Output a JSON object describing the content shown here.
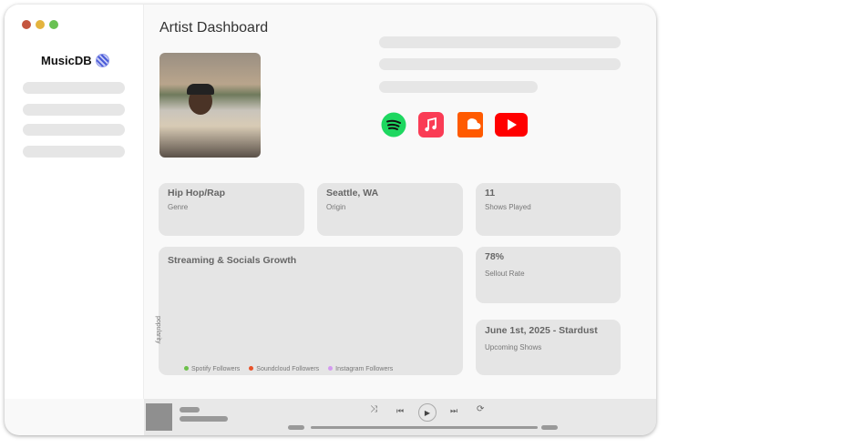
{
  "window": {
    "controls": {
      "close": "#c4553f",
      "minimize": "#e4b43e",
      "maximize": "#69c152"
    }
  },
  "sidebar": {
    "brand": "MusicDB",
    "logo_icon": "globe-logo-icon"
  },
  "main": {
    "title": "Artist Dashboard",
    "socials": [
      {
        "name": "Spotify",
        "icon": "spotify-icon",
        "color": "#1ed760"
      },
      {
        "name": "Apple Music",
        "icon": "apple-music-icon",
        "color": "#fa2d48"
      },
      {
        "name": "SoundCloud",
        "icon": "soundcloud-icon",
        "color": "#ff5500"
      },
      {
        "name": "YouTube",
        "icon": "youtube-icon",
        "color": "#ff0000"
      }
    ],
    "stats": {
      "genre": {
        "value": "Hip Hop/Rap",
        "label": "Genre"
      },
      "origin": {
        "value": "Seattle, WA",
        "label": "Origin"
      },
      "shows": {
        "value": "11",
        "label": "Shows Played"
      },
      "sellout": {
        "value": "78%",
        "label": "Sellout Rate"
      },
      "upcoming": {
        "value": "June 1st, 2025 - Stardust",
        "label": "Upcoming Shows"
      }
    },
    "chart": {
      "title": "Streaming & Socials Growth",
      "ylabel": "popularity",
      "legend": [
        {
          "name": "Spotify Followers",
          "color": "#6cc04a"
        },
        {
          "name": "Soundcloud Followers",
          "color": "#e8532b"
        },
        {
          "name": "Instagram Followers",
          "color": "#d49af0"
        }
      ]
    }
  },
  "player": {
    "controls": [
      "shuffle-icon",
      "previous-icon",
      "play-icon",
      "next-icon",
      "repeat-icon"
    ]
  }
}
